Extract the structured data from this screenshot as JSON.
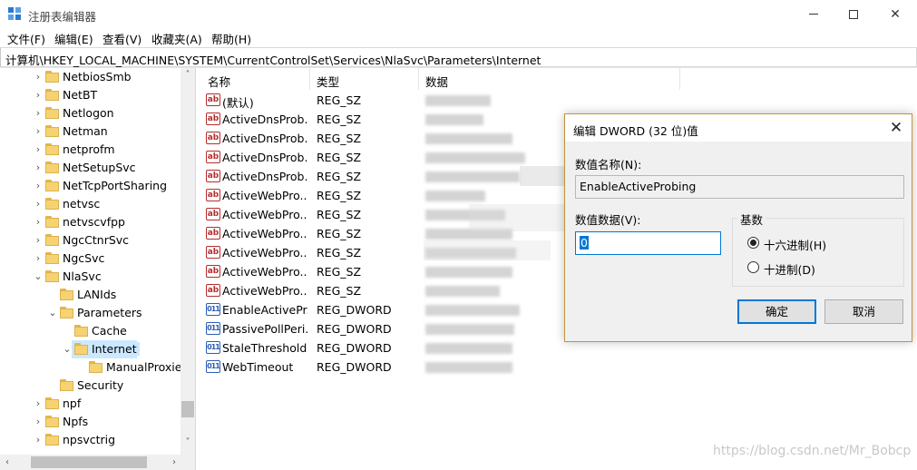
{
  "window": {
    "title": "注册表编辑器",
    "minimize": "—",
    "maximize": "☐",
    "close": "✕"
  },
  "menu": [
    "文件(F)",
    "编辑(E)",
    "查看(V)",
    "收藏夹(A)",
    "帮助(H)"
  ],
  "address": "计算机\\HKEY_LOCAL_MACHINE\\SYSTEM\\CurrentControlSet\\Services\\NlaSvc\\Parameters\\Internet",
  "tree": [
    {
      "label": "NetbiosSmb",
      "level": 0,
      "expander": "›"
    },
    {
      "label": "NetBT",
      "level": 0,
      "expander": "›"
    },
    {
      "label": "Netlogon",
      "level": 0,
      "expander": "›"
    },
    {
      "label": "Netman",
      "level": 0,
      "expander": "›"
    },
    {
      "label": "netprofm",
      "level": 0,
      "expander": "›"
    },
    {
      "label": "NetSetupSvc",
      "level": 0,
      "expander": "›"
    },
    {
      "label": "NetTcpPortSharing",
      "level": 0,
      "expander": "›"
    },
    {
      "label": "netvsc",
      "level": 0,
      "expander": "›"
    },
    {
      "label": "netvscvfpp",
      "level": 0,
      "expander": "›"
    },
    {
      "label": "NgcCtnrSvc",
      "level": 0,
      "expander": "›"
    },
    {
      "label": "NgcSvc",
      "level": 0,
      "expander": "›"
    },
    {
      "label": "NlaSvc",
      "level": 0,
      "expander": "⌄"
    },
    {
      "label": "LANIds",
      "level": 1,
      "expander": ""
    },
    {
      "label": "Parameters",
      "level": 1,
      "expander": "⌄"
    },
    {
      "label": "Cache",
      "level": 2,
      "expander": ""
    },
    {
      "label": "Internet",
      "level": 2,
      "expander": "⌄",
      "selected": true
    },
    {
      "label": "ManualProxies",
      "level": 3,
      "expander": ""
    },
    {
      "label": "Security",
      "level": 1,
      "expander": ""
    },
    {
      "label": "npf",
      "level": 0,
      "expander": "›"
    },
    {
      "label": "Npfs",
      "level": 0,
      "expander": "›"
    },
    {
      "label": "npsvctrig",
      "level": 0,
      "expander": "›"
    }
  ],
  "columns": {
    "name": "名称",
    "type": "类型",
    "data": "数据"
  },
  "values": [
    {
      "name": "(默认)",
      "type": "REG_SZ",
      "kind": "sz"
    },
    {
      "name": "ActiveDnsProb...",
      "type": "REG_SZ",
      "kind": "sz"
    },
    {
      "name": "ActiveDnsProb...",
      "type": "REG_SZ",
      "kind": "sz"
    },
    {
      "name": "ActiveDnsProb...",
      "type": "REG_SZ",
      "kind": "sz"
    },
    {
      "name": "ActiveDnsProb...",
      "type": "REG_SZ",
      "kind": "sz"
    },
    {
      "name": "ActiveWebPro...",
      "type": "REG_SZ",
      "kind": "sz"
    },
    {
      "name": "ActiveWebPro...",
      "type": "REG_SZ",
      "kind": "sz"
    },
    {
      "name": "ActiveWebPro...",
      "type": "REG_SZ",
      "kind": "sz"
    },
    {
      "name": "ActiveWebPro...",
      "type": "REG_SZ",
      "kind": "sz"
    },
    {
      "name": "ActiveWebPro...",
      "type": "REG_SZ",
      "kind": "sz"
    },
    {
      "name": "ActiveWebPro...",
      "type": "REG_SZ",
      "kind": "sz"
    },
    {
      "name": "EnableActivePr...",
      "type": "REG_DWORD",
      "kind": "dword"
    },
    {
      "name": "PassivePollPeri...",
      "type": "REG_DWORD",
      "kind": "dword"
    },
    {
      "name": "StaleThreshold",
      "type": "REG_DWORD",
      "kind": "dword"
    },
    {
      "name": "WebTimeout",
      "type": "REG_DWORD",
      "kind": "dword"
    }
  ],
  "icons": {
    "sz": "ab",
    "dword": "011"
  },
  "dialog": {
    "title": "编辑 DWORD (32 位)值",
    "close": "✕",
    "name_label": "数值名称(N):",
    "name_value": "EnableActiveProbing",
    "data_label": "数值数据(V):",
    "data_value": "0",
    "base_label": "基数",
    "radio_hex": "十六进制(H)",
    "radio_dec": "十进制(D)",
    "ok": "确定",
    "cancel": "取消"
  },
  "watermark": "https://blog.csdn.net/Mr_Bobcp",
  "colors": {
    "accent": "#0078d7",
    "selection": "#cce8ff",
    "folder": "#f6d372"
  }
}
